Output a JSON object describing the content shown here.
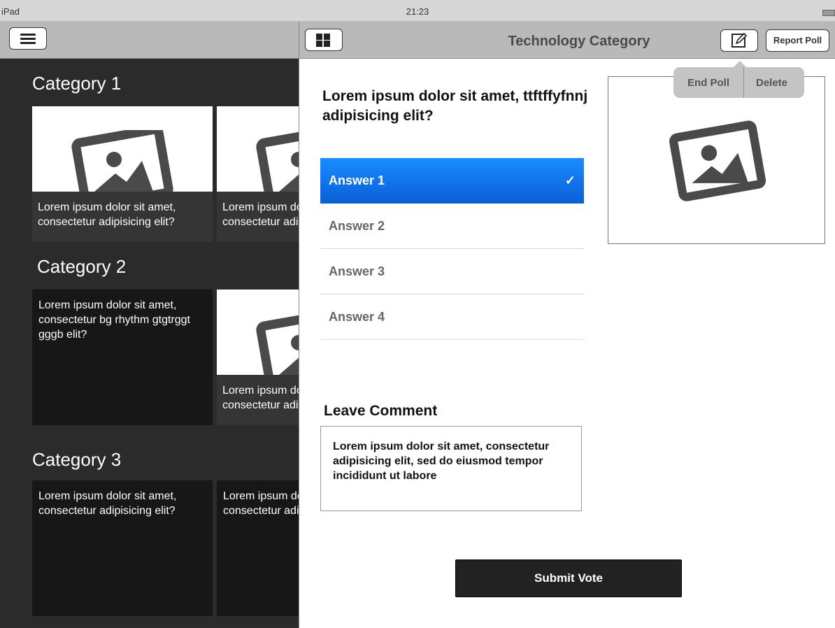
{
  "status": {
    "device": "iPad",
    "time": "21:23"
  },
  "categories": [
    {
      "title": "Category 1",
      "tiles": [
        {
          "caption": "Lorem ipsum dolor sit amet,\nconsectetur adipisicing elit?"
        },
        {
          "caption": "Lorem ipsum dolor sit amet,\nconsectetur adipisicing elit?"
        }
      ]
    },
    {
      "title": "Category 2",
      "tiles": [
        {
          "text": "Lorem ipsum dolor sit amet, consectetur bg rhythm gtgtrggt gggb elit?"
        },
        {
          "caption": "Lorem ipsum dolor sit amet,\nconsectetur adipisicing elit?"
        }
      ]
    },
    {
      "title": "Category 3",
      "tiles": [
        {
          "text": "Lorem ipsum dolor sit amet, consectetur adipisicing elit?"
        },
        {
          "text": "Lorem ipsum dolor sit amet, consectetur adipisicing elit?"
        }
      ]
    }
  ],
  "panel": {
    "title": "Technology Category",
    "report_label": "Report Poll",
    "popover": {
      "end_poll": "End Poll",
      "delete": "Delete"
    },
    "question": "Lorem ipsum dolor sit amet, ttftffyfnnj adipisicing elit?",
    "answers": [
      {
        "label": "Answer 1",
        "check": "✓"
      },
      {
        "label": "Answer 2"
      },
      {
        "label": "Answer 3"
      },
      {
        "label": "Answer 4"
      }
    ],
    "comment_label": "Leave Comment",
    "comment_text": "Lorem ipsum dolor sit amet, consectetur adipisicing elit, sed do eiusmod tempor incididunt ut labore",
    "submit_label": "Submit Vote"
  },
  "colors": {
    "selected_answer": "#0a6fe8",
    "dark_bg": "#2b2b2b",
    "toolbar": "#b9b9b9"
  },
  "icons": [
    "menu-icon",
    "grid-icon",
    "edit-icon",
    "photo-placeholder-icon",
    "checkmark-icon"
  ]
}
